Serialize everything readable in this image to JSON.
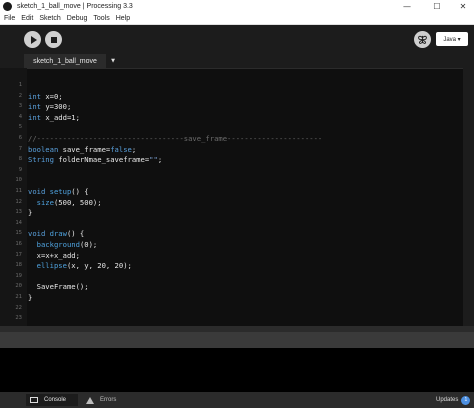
{
  "window": {
    "title": "sketch_1_ball_move | Processing 3.3",
    "min_glyph": "—",
    "max_glyph": "☐",
    "close_glyph": "✕"
  },
  "menu": [
    "File",
    "Edit",
    "Sketch",
    "Debug",
    "Tools",
    "Help"
  ],
  "toolbar": {
    "mode_label": "Java ▾",
    "debug_icon": "butterfly-icon"
  },
  "tab": {
    "name": "sketch_1_ball_move",
    "menu_glyph": "▼"
  },
  "editor": {
    "lines": [
      {
        "n": "1",
        "code": ""
      },
      {
        "n": "2",
        "code": "int x=0;"
      },
      {
        "n": "3",
        "code": "int y=300;"
      },
      {
        "n": "4",
        "code": "int x_add=1;"
      },
      {
        "n": "5",
        "code": ""
      },
      {
        "n": "6",
        "code": "//----------------------------------save_frame----------------------"
      },
      {
        "n": "7",
        "code": "boolean save_frame=false;"
      },
      {
        "n": "8",
        "code": "String folderNmae_saveframe=\"\";"
      },
      {
        "n": "9",
        "code": ""
      },
      {
        "n": "10",
        "code": ""
      },
      {
        "n": "11",
        "code": "void setup() {"
      },
      {
        "n": "12",
        "code": "  size(500, 500);"
      },
      {
        "n": "13",
        "code": "}"
      },
      {
        "n": "14",
        "code": ""
      },
      {
        "n": "15",
        "code": "void draw() {"
      },
      {
        "n": "16",
        "code": "  background(0);"
      },
      {
        "n": "17",
        "code": "  x=x+x_add;"
      },
      {
        "n": "18",
        "code": "  ellipse(x, y, 20, 20);"
      },
      {
        "n": "19",
        "code": ""
      },
      {
        "n": "20",
        "code": "  SaveFrame();"
      },
      {
        "n": "21",
        "code": "}"
      },
      {
        "n": "22",
        "code": ""
      },
      {
        "n": "23",
        "code": ""
      }
    ]
  },
  "bottom": {
    "console_label": "Console",
    "errors_label": "Errors",
    "updates_label": "Updates",
    "updates_count": "1"
  }
}
